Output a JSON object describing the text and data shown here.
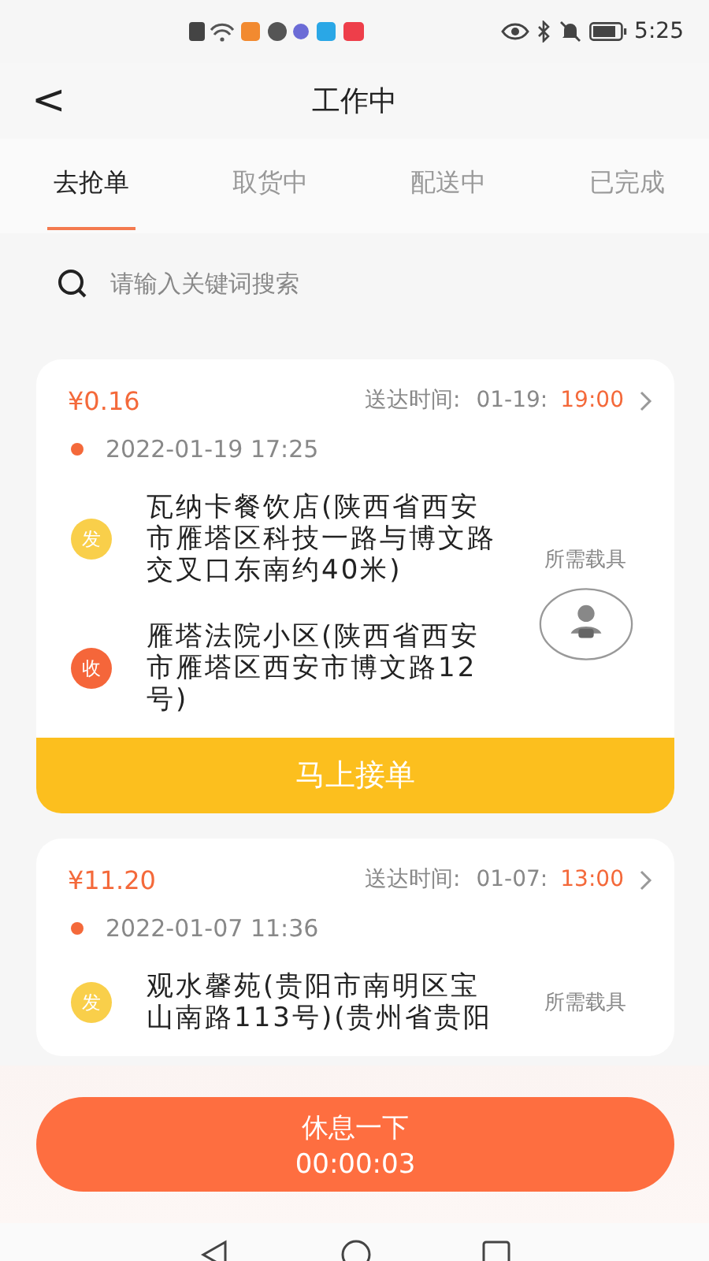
{
  "status_bar": {
    "time": "5:25"
  },
  "header": {
    "back": "<",
    "title": "工作中"
  },
  "tabs": [
    {
      "label": "去抢单",
      "selected": true
    },
    {
      "label": "取货中",
      "selected": false
    },
    {
      "label": "配送中",
      "selected": false
    },
    {
      "label": "已完成",
      "selected": false
    }
  ],
  "search": {
    "placeholder": "请输入关键词搜索"
  },
  "orders": [
    {
      "price": "¥0.16",
      "deadline_label": "送达时间:",
      "deadline_date": "01-19:",
      "deadline_time": "19:00",
      "created": "2022-01-19 17:25",
      "stops": [
        {
          "kind": "send",
          "badge": "发",
          "address": "瓦纳卡餐饮店(陕西省西安市雁塔区科技一路与博文路交叉口东南约40米)"
        },
        {
          "kind": "receive",
          "badge": "收",
          "address": "雁塔法院小区(陕西省西安市雁塔区西安市博文路12号)"
        }
      ],
      "vehicle_label": "所需载具",
      "vehicle_icon": true,
      "accept": "马上接单"
    },
    {
      "price": "¥11.20",
      "deadline_label": "送达时间:",
      "deadline_date": "01-07:",
      "deadline_time": "13:00",
      "created": "2022-01-07 11:36",
      "stops": [
        {
          "kind": "send",
          "badge": "发",
          "address": "观水馨苑(贵阳市南明区宝山南路113号)(贵州省贵阳"
        }
      ],
      "vehicle_label": "所需载具",
      "vehicle_icon": false
    }
  ],
  "rest_button": {
    "label": "休息一下",
    "timer": "00:00:03"
  }
}
